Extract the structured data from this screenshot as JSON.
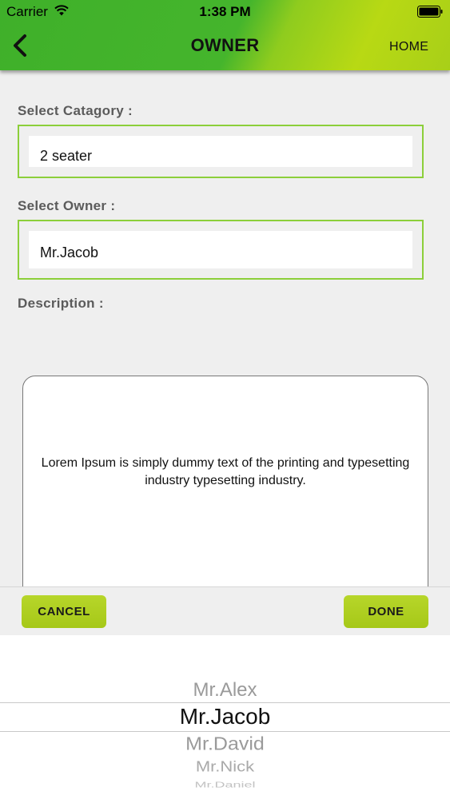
{
  "status_bar": {
    "carrier": "Carrier",
    "time": "1:38 PM"
  },
  "nav": {
    "title": "OWNER",
    "home_label": "HOME"
  },
  "form": {
    "category_label": "Select Catagory :",
    "category_value": "2 seater",
    "owner_label": "Select Owner :",
    "owner_value": "Mr.Jacob",
    "description_label": "Description :",
    "description_text": "Lorem Ipsum is simply dummy text of the printing and typesetting industry typesetting industry."
  },
  "picker": {
    "cancel_label": "CANCEL",
    "done_label": "DONE",
    "options": [
      "Mr.Alex",
      "Mr.Jacob",
      "Mr.David",
      "Mr.Nick",
      "Mr.Daniel"
    ],
    "selected": "Mr.Jacob"
  },
  "colors": {
    "header_green": "#45b52c",
    "header_yellow": "#b8d914",
    "field_border": "#8ccf3a",
    "button_bg": "#a6c818"
  }
}
